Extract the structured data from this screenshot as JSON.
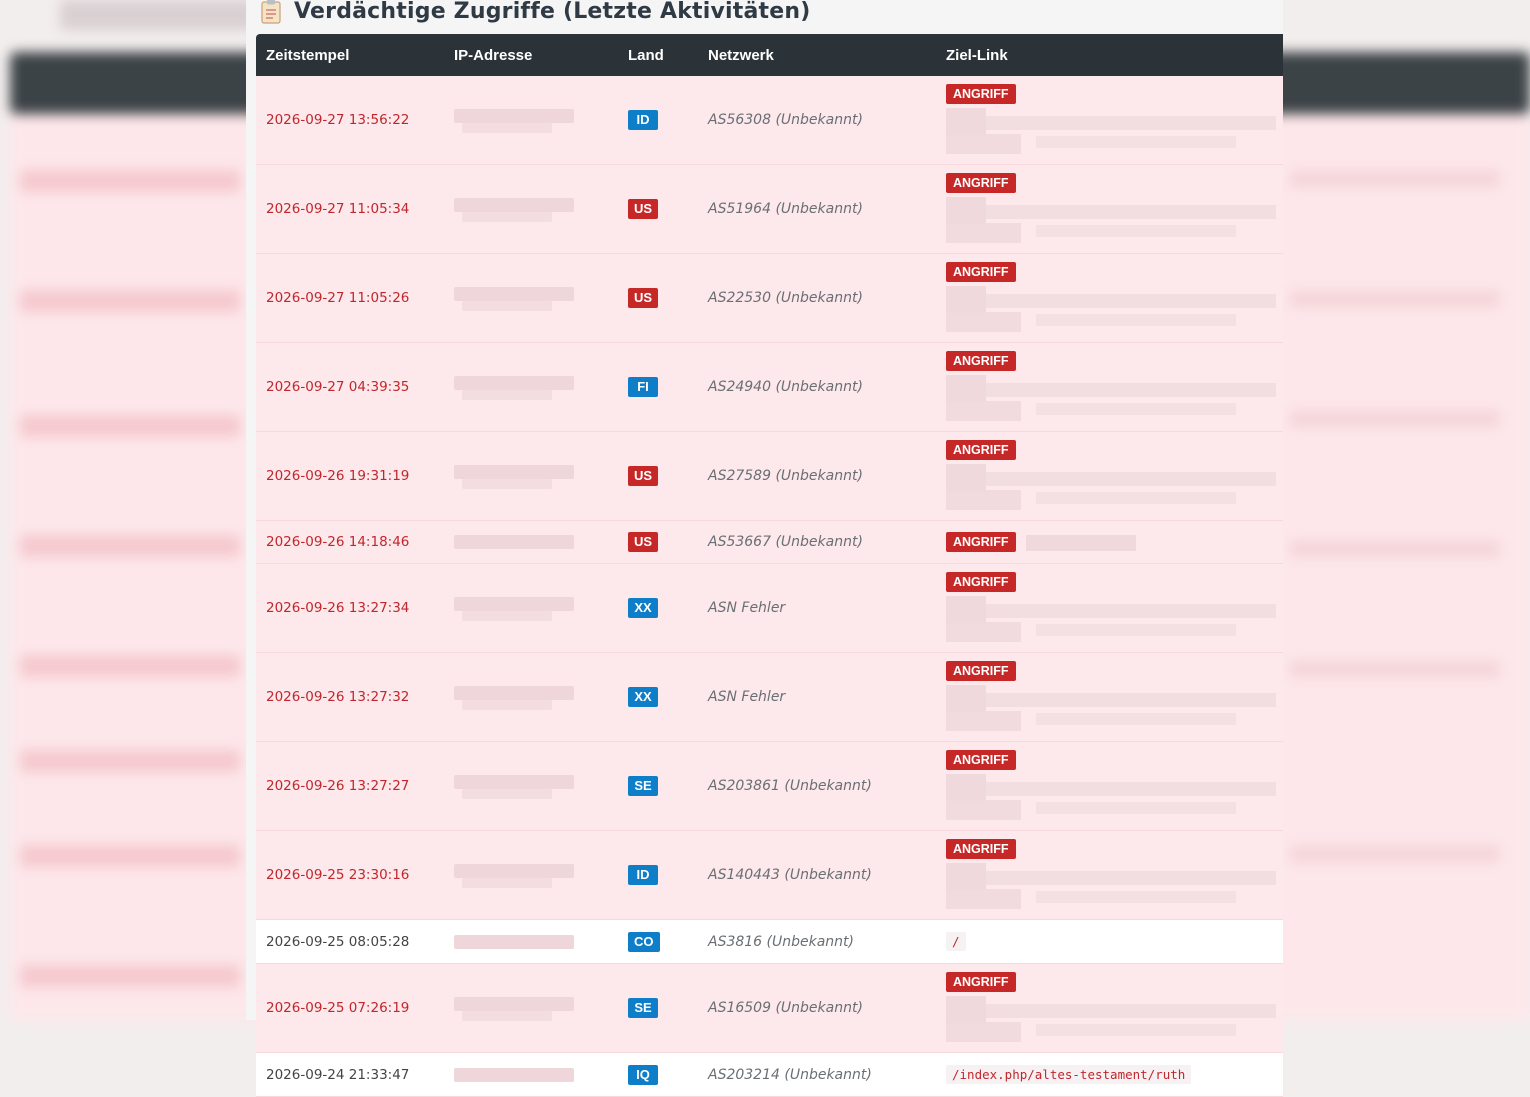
{
  "page": {
    "title": "Verdächtige Zugriffe (Letzte Aktivitäten)",
    "title_icon": "clipboard-icon"
  },
  "table": {
    "headers": [
      "Zeitstempel",
      "IP-Adresse",
      "Land",
      "Netzwerk",
      "Ziel-Link"
    ],
    "badge_label": "ANGRIFF",
    "rows": [
      {
        "timestamp": "2026-09-27 13:56:22",
        "country": "ID",
        "network": "AS56308 (Unbekannt)",
        "attack": true,
        "path": ""
      },
      {
        "timestamp": "2026-09-27 11:05:34",
        "country": "US",
        "network": "AS51964 (Unbekannt)",
        "attack": true,
        "path": ""
      },
      {
        "timestamp": "2026-09-27 11:05:26",
        "country": "US",
        "network": "AS22530 (Unbekannt)",
        "attack": true,
        "path": ""
      },
      {
        "timestamp": "2026-09-27 04:39:35",
        "country": "FI",
        "network": "AS24940 (Unbekannt)",
        "attack": true,
        "path": ""
      },
      {
        "timestamp": "2026-09-26 19:31:19",
        "country": "US",
        "network": "AS27589 (Unbekannt)",
        "attack": true,
        "path": ""
      },
      {
        "timestamp": "2026-09-26 14:18:46",
        "country": "US",
        "network": "AS53667 (Unbekannt)",
        "attack": true,
        "path": ""
      },
      {
        "timestamp": "2026-09-26 13:27:34",
        "country": "XX",
        "network": "ASN Fehler",
        "attack": true,
        "path": ""
      },
      {
        "timestamp": "2026-09-26 13:27:32",
        "country": "XX",
        "network": "ASN Fehler",
        "attack": true,
        "path": ""
      },
      {
        "timestamp": "2026-09-26 13:27:27",
        "country": "SE",
        "network": "AS203861 (Unbekannt)",
        "attack": true,
        "path": ""
      },
      {
        "timestamp": "2026-09-25 23:30:16",
        "country": "ID",
        "network": "AS140443 (Unbekannt)",
        "attack": true,
        "path": ""
      },
      {
        "timestamp": "2026-09-25 08:05:28",
        "country": "CO",
        "network": "AS3816 (Unbekannt)",
        "attack": false,
        "path": "/"
      },
      {
        "timestamp": "2026-09-25 07:26:19",
        "country": "SE",
        "network": "AS16509 (Unbekannt)",
        "attack": true,
        "path": ""
      },
      {
        "timestamp": "2026-09-24 21:33:47",
        "country": "IQ",
        "network": "AS203214 (Unbekannt)",
        "attack": false,
        "path": "/index.php/altes-testament/ruth"
      }
    ]
  },
  "colors": {
    "header_bg": "#2c3338",
    "attack_row_bg": "#fde8eb",
    "attack_text": "#c0272d",
    "flag_blue": "#0f7ec8",
    "flag_red": "#c62828"
  }
}
